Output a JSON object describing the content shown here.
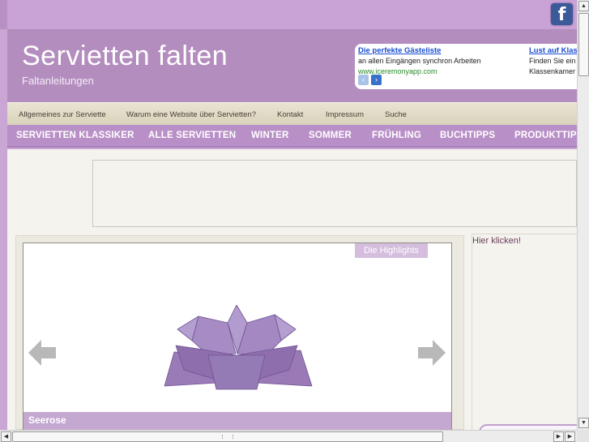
{
  "site": {
    "title": "Servietten falten",
    "subtitle": "Faltanleitungen",
    "facebook_glyph": "f"
  },
  "ads": [
    {
      "title": "Die perfekte Gästeliste",
      "text": "an allen Eingängen synchron Arbeiten",
      "url": "www.iceremonyapp.com"
    },
    {
      "title": "Lust auf Klas",
      "text": "Finden Sie ein",
      "text2": "Klassenkamer"
    }
  ],
  "ad_nav": {
    "prev": "‹",
    "next": "›"
  },
  "top_menu": [
    "Allgemeines zur Serviette",
    "Warum eine Website über Servietten?",
    "Kontakt",
    "Impressum",
    "Suche"
  ],
  "categories": [
    "SERVIETTEN KLASSIKER",
    "ALLE SERVIETTEN",
    "WINTER",
    "SOMMER",
    "FRÜHLING",
    "BUCHTIPPS",
    "PRODUKTTIPPS"
  ],
  "slider": {
    "tab_label": "Die Highlights",
    "caption": "Seerose"
  },
  "sidebar": {
    "link": "Hier klicken!"
  },
  "colors": {
    "header_purple": "#b48dbf",
    "nav_purple": "#b98fc7",
    "napkin_purple": "#9b7ab8",
    "link_blue": "#1a4fd0"
  },
  "icons": [
    "facebook-icon",
    "arrow-left-icon",
    "arrow-right-icon",
    "napkin-image"
  ],
  "scrollbar": {
    "up": "▲",
    "down": "▼",
    "left": "◀",
    "right": "▶"
  }
}
